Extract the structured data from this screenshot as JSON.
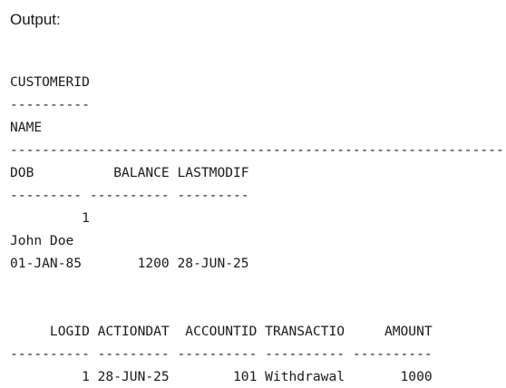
{
  "header": {
    "label": "Output:"
  },
  "console": {
    "lines": [
      "CUSTOMERID",
      "----------",
      "NAME",
      "--------------------------------------------------------------------------------",
      "DOB          BALANCE LASTMODIF",
      "--------- ---------- ---------",
      "         1",
      "John Doe",
      "01-JAN-85       1200 28-JUN-25",
      "",
      "",
      "     LOGID ACTIONDAT  ACCOUNTID TRANSACTIO     AMOUNT",
      "---------- --------- ---------- ---------- ----------",
      "         1 28-JUN-25        101 Withdrawal       1000"
    ]
  }
}
